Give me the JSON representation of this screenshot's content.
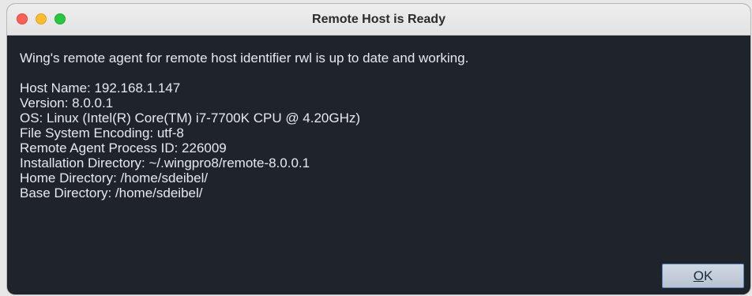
{
  "window": {
    "title": "Remote Host is Ready"
  },
  "message": "Wing's remote agent for remote host identifier rwl is up to date and working.",
  "details": [
    "Host Name: 192.168.1.147",
    "Version: 8.0.0.1",
    "OS: Linux (Intel(R) Core(TM) i7-7700K CPU @ 4.20GHz)",
    "File System Encoding: utf-8",
    "Remote Agent Process ID: 226009",
    "Installation Directory: ~/.wingpro8/remote-8.0.0.1",
    "Home Directory: /home/sdeibel/",
    "Base Directory: /home/sdeibel/"
  ],
  "buttons": {
    "ok_mnemonic": "O",
    "ok_rest": "K"
  },
  "colors": {
    "background": "#1f242b",
    "text": "#e6e9ee",
    "button_border": "#5a87c4"
  }
}
